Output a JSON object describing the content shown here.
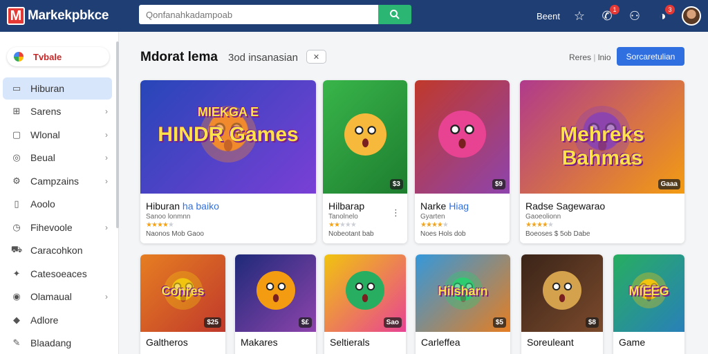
{
  "header": {
    "logo_letter": "M",
    "app_name": "Markekpbkce",
    "search_placeholder": "Qonfanahkadampoab",
    "top_link": "Beent",
    "notif_badge": "1",
    "account_badge": "3"
  },
  "sidebar": {
    "top_label": "Tvbale",
    "items": [
      {
        "label": "Hiburan",
        "icon": "gamepad-icon",
        "glyph": "▭",
        "chevron": false,
        "active": true
      },
      {
        "label": "Sarens",
        "icon": "grid-icon",
        "glyph": "⊞",
        "chevron": true,
        "active": false
      },
      {
        "label": "Wlonal",
        "icon": "monitor-icon",
        "glyph": "▢",
        "chevron": true,
        "active": false
      },
      {
        "label": "Beual",
        "icon": "target-icon",
        "glyph": "◎",
        "chevron": true,
        "active": false
      },
      {
        "label": "Campzains",
        "icon": "settings-icon",
        "glyph": "⚙",
        "chevron": true,
        "active": false
      },
      {
        "label": "Aoolo",
        "icon": "phone-icon",
        "glyph": "▯",
        "chevron": false,
        "active": false
      },
      {
        "label": "Fihevoole",
        "icon": "clock-icon",
        "glyph": "◷",
        "chevron": true,
        "active": false
      },
      {
        "label": "Caracohkon",
        "icon": "car-icon",
        "glyph": "⛟",
        "chevron": false,
        "active": false
      },
      {
        "label": "Catesoeaces",
        "icon": "gift-icon",
        "glyph": "✦",
        "chevron": false,
        "active": false
      },
      {
        "label": "Olamaual",
        "icon": "user-icon",
        "glyph": "◉",
        "chevron": true,
        "active": false
      },
      {
        "label": "Adlore",
        "icon": "chat-icon",
        "glyph": "◆",
        "chevron": false,
        "active": false
      },
      {
        "label": "Blaadang",
        "icon": "bag-icon",
        "glyph": "✎",
        "chevron": false,
        "active": false
      }
    ]
  },
  "main": {
    "title": "Mdorat lema",
    "subtitle": "3od insanasian",
    "close_chip": "✕",
    "link_label": "Reres",
    "link_label_2": "lnio",
    "button_label": "Sorcaretulian"
  },
  "cards_row1": [
    {
      "title": "Hiburan",
      "title_accent": "ha baiko",
      "sub": "Sanoo lonmnn",
      "stars": 4,
      "meta": "Naonos Mob Gaoo",
      "tag": "",
      "thumb_text": "HINDR Games",
      "thumb_top": "MIEKGA E",
      "colors": [
        "#2746b8",
        "#7a3fd6",
        "#f08a2c"
      ]
    },
    {
      "title": "Hilbarap",
      "title_accent": "",
      "sub": "Tanolnelo",
      "stars": 2,
      "meta": "Nobeotant bab",
      "tag": "$3",
      "thumb_text": "",
      "thumb_top": "",
      "colors": [
        "#39b54a",
        "#1d7d2f",
        "#f6b93b"
      ]
    },
    {
      "title": "Narke",
      "title_accent": "Hiag",
      "sub": "Gyarten",
      "stars": 4,
      "meta": "Noes Hols dob",
      "tag": "$9",
      "thumb_text": "",
      "thumb_top": "",
      "colors": [
        "#c0392b",
        "#8e44ad",
        "#e84393"
      ]
    },
    {
      "title": "Radse Sagewarao",
      "title_accent": "",
      "sub": "Gaoeolionn",
      "stars": 4,
      "meta": "Boeoses $ 5ob Dabe",
      "tag": "Gaaa",
      "thumb_text": "Mehreks Bahmas",
      "thumb_top": "",
      "colors": [
        "#b03a8c",
        "#f39c12",
        "#8e44ad"
      ]
    }
  ],
  "cards_row2": [
    {
      "title": "Galtheros",
      "tag": "$25",
      "thumb_text": "Conres",
      "colors": [
        "#e67e22",
        "#c0392b",
        "#f1c40f"
      ]
    },
    {
      "title": "Makares",
      "tag": "$£",
      "thumb_text": "",
      "colors": [
        "#1e2a78",
        "#8e44ad",
        "#f39c12"
      ]
    },
    {
      "title": "Seltierals",
      "tag": "Sao",
      "thumb_text": "",
      "colors": [
        "#f1c40f",
        "#e84393",
        "#27ae60"
      ]
    },
    {
      "title": "Carleffea",
      "tag": "$5",
      "thumb_text": "Hilsharn",
      "colors": [
        "#3498db",
        "#e67e22",
        "#2ecc71"
      ]
    },
    {
      "title": "Soreuleant",
      "tag": "$8",
      "thumb_text": "",
      "colors": [
        "#3a2418",
        "#7b4a2c",
        "#d4a24c"
      ]
    },
    {
      "title": "Game",
      "tag": "",
      "thumb_text": "MIEEG",
      "colors": [
        "#27ae60",
        "#2980b9",
        "#f1c40f"
      ]
    }
  ],
  "colors": {
    "topbar": "#1f3e74",
    "search_button": "#2bb673",
    "primary_button": "#2f6fe0",
    "sidebar_active": "#d8e6fb"
  }
}
